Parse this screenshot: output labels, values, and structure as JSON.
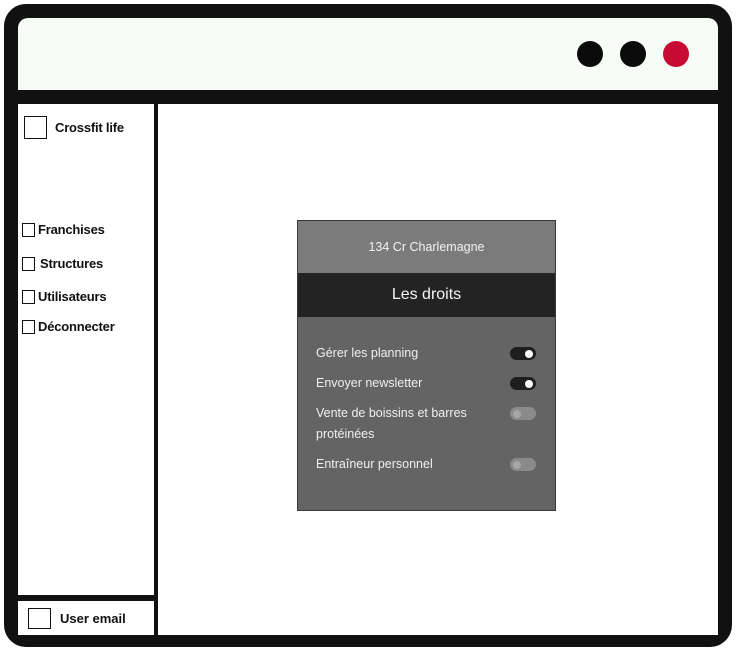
{
  "window": {
    "controls": [
      {
        "name": "window-control-1",
        "color": "#0b0b0b"
      },
      {
        "name": "window-control-2",
        "color": "#0b0b0b"
      },
      {
        "name": "window-control-close",
        "color": "#c70a32"
      }
    ]
  },
  "sidebar": {
    "brand": "Crossfit life",
    "items": [
      {
        "label": "Franchises"
      },
      {
        "label": "Structures"
      },
      {
        "label": "Utilisateurs"
      },
      {
        "label": "Déconnecter"
      }
    ],
    "footer": {
      "user_email": "User email"
    }
  },
  "panel": {
    "address": "134 Cr Charlemagne",
    "title": "Les droits",
    "permissions": [
      {
        "label": "Gérer les planning",
        "enabled": true
      },
      {
        "label": "Envoyer newsletter",
        "enabled": true
      },
      {
        "label": "Vente de boissins et barres protéinées",
        "enabled": false
      },
      {
        "label": "Entraîneur personnel",
        "enabled": false
      }
    ]
  }
}
